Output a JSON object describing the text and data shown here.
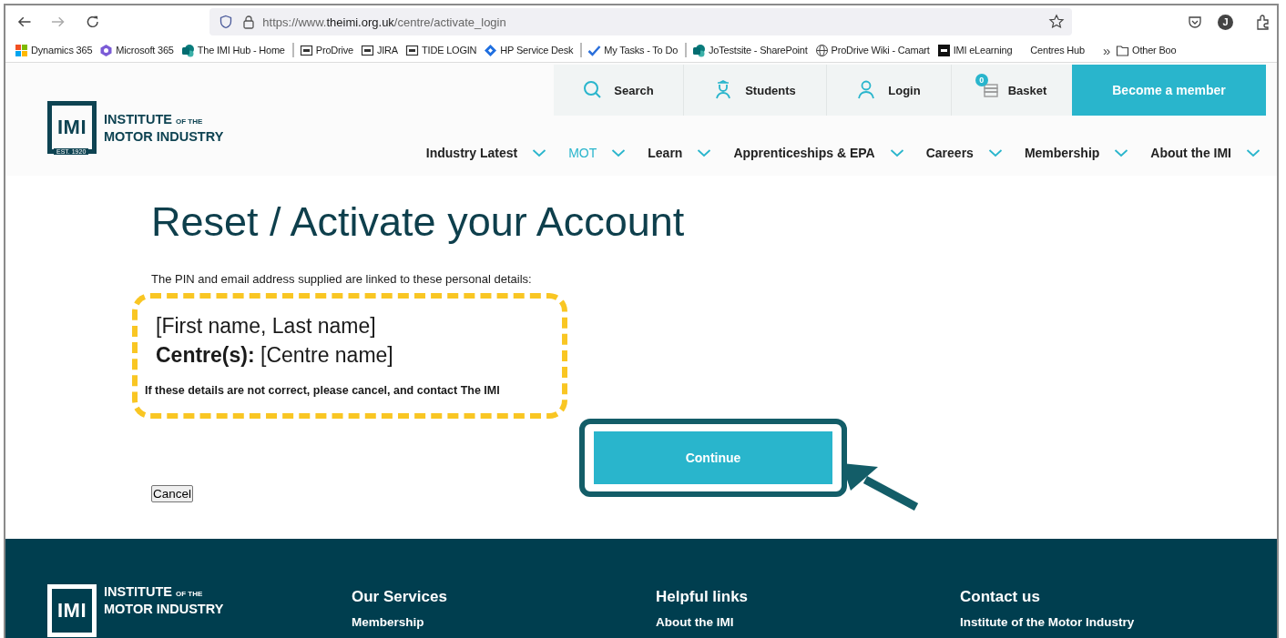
{
  "browser": {
    "url_prefix": "https://www.",
    "url_domain": "theimi.org.uk",
    "url_path": "/centre/activate_login",
    "avatar": "J"
  },
  "bookmarks": [
    {
      "label": "Dynamics 365",
      "kind": "grid"
    },
    {
      "label": "Microsoft 365",
      "kind": "m365"
    },
    {
      "label": "The IMI Hub - Home",
      "kind": "sharepoint"
    },
    {
      "label": "ProDrive",
      "kind": "imi",
      "separator_before": true
    },
    {
      "label": "JIRA",
      "kind": "imi"
    },
    {
      "label": "TIDE LOGIN",
      "kind": "imi"
    },
    {
      "label": "HP Service Desk",
      "kind": "diamond"
    },
    {
      "label": "My Tasks - To Do",
      "kind": "check",
      "separator_before": true
    },
    {
      "label": "JoTestsite - SharePoint",
      "kind": "sharepoint",
      "separator_before": true
    },
    {
      "label": "ProDrive Wiki - Camart",
      "kind": "globe"
    },
    {
      "label": "IMI eLearning",
      "kind": "imi-dark"
    },
    {
      "label": "Centres Hub",
      "kind": "blank"
    }
  ],
  "bookmarks_more": "»",
  "bookmarks_other": "Other Boo",
  "logo": {
    "mark": "IMI",
    "line1": "INSTITUTE",
    "line1_small": "OF THE",
    "line2": "MOTOR INDUSTRY",
    "est": "EST. 1920"
  },
  "utility": [
    {
      "label": "Search",
      "kind": "search"
    },
    {
      "label": "Students",
      "kind": "students"
    },
    {
      "label": "Login",
      "kind": "login"
    },
    {
      "label": "Basket",
      "kind": "basket",
      "badge": "0"
    }
  ],
  "become_member": "Become a member",
  "nav": [
    {
      "label": "Industry Latest",
      "selected": false
    },
    {
      "label": "MOT",
      "selected": true
    },
    {
      "label": "Learn",
      "selected": false
    },
    {
      "label": "Apprenticeships & EPA",
      "selected": false
    },
    {
      "label": "Careers",
      "selected": false
    },
    {
      "label": "Membership",
      "selected": false
    },
    {
      "label": "About the IMI",
      "selected": false
    }
  ],
  "page": {
    "title": "Reset / Activate your Account",
    "intro": "The PIN and email address supplied are linked to these personal details:",
    "name": "[First name, Last name]",
    "centre": "**Centre(s):** [Centre name]",
    "warning": "If these details are not correct, please cancel, and contact The IMI",
    "continue": "Continue",
    "cancel": "Cancel"
  },
  "footer": {
    "logo": {
      "mark": "IMI",
      "line1": "INSTITUTE",
      "line1_small": "OF THE",
      "line2": "MOTOR INDUSTRY"
    },
    "columns": [
      {
        "heading": "Our Services",
        "link": "Membership"
      },
      {
        "heading": "Helpful links",
        "link": "About the IMI"
      },
      {
        "heading": "Contact us",
        "link": "Institute of the Motor Industry"
      }
    ]
  }
}
